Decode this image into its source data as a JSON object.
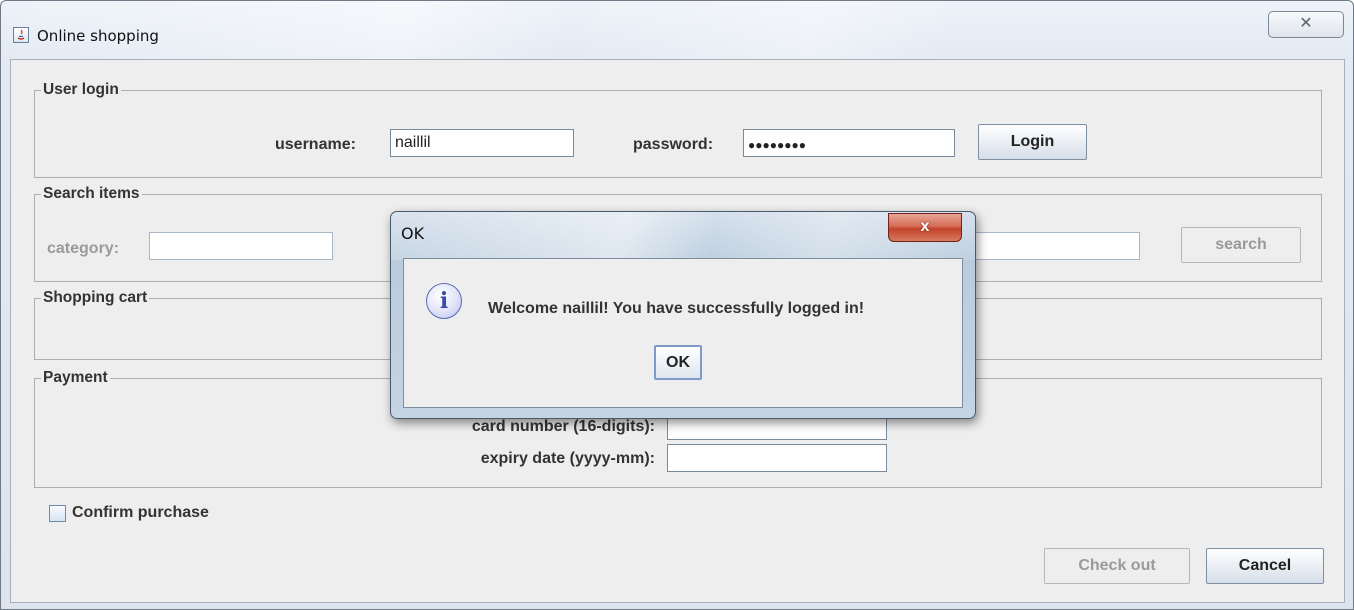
{
  "window": {
    "title": "Online shopping",
    "close_glyph": "✕"
  },
  "login": {
    "title": "User login",
    "username_label": "username:",
    "username_value": "naillil",
    "password_label": "password:",
    "password_masked": "●●●●●●●●",
    "login_button": "Login"
  },
  "search": {
    "title": "Search items",
    "category_label": "category:",
    "category_value": "",
    "keyword_value": "",
    "search_button": "search"
  },
  "cart": {
    "title": "Shopping cart"
  },
  "payment": {
    "title": "Payment",
    "card_label": "card number (16-digits):",
    "card_value": "",
    "expiry_label": "expiry date (yyyy-mm):",
    "expiry_value": ""
  },
  "confirm": {
    "label": "Confirm purchase",
    "checked": false
  },
  "actions": {
    "checkout_button": "Check out",
    "cancel_button": "Cancel"
  },
  "dialog": {
    "title": "OK",
    "close_glyph": "x",
    "icon": "info-icon",
    "icon_glyph": "i",
    "message": "Welcome naillil! You have successfully logged in!",
    "ok_button": "OK"
  }
}
